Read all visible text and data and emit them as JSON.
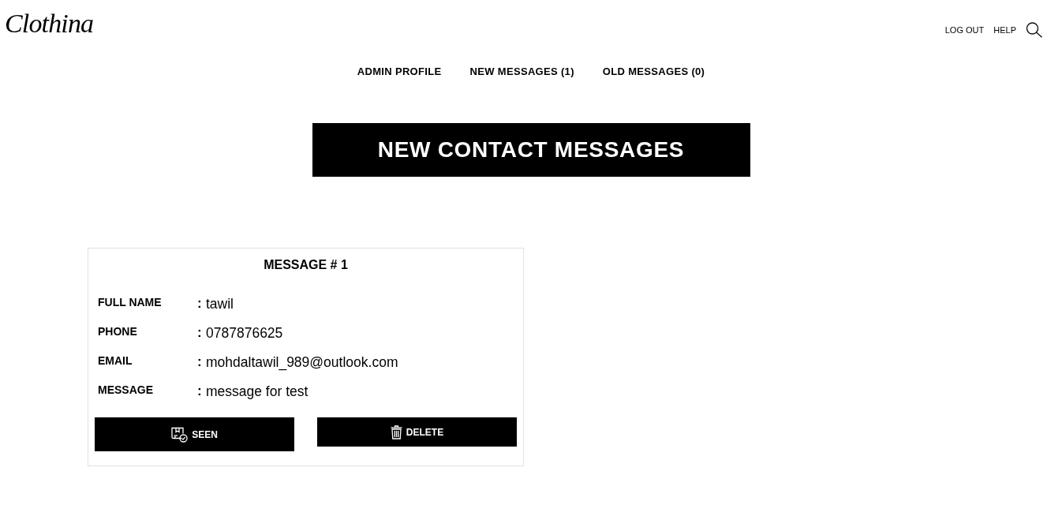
{
  "logo": {
    "text": "Clothina"
  },
  "header_links": [
    {
      "label": "LOG OUT"
    },
    {
      "label": "HELP"
    }
  ],
  "nav": [
    {
      "label": "ADMIN PROFILE"
    },
    {
      "label": "NEW MESSAGES (1)"
    },
    {
      "label": "OLD MESSAGES (0)"
    }
  ],
  "page_title": "NEW CONTACT MESSAGES",
  "messages": [
    {
      "title": "MESSAGE # 1",
      "fields": [
        {
          "label": "FULL NAME",
          "separator": ":",
          "value": "tawil"
        },
        {
          "label": "PHONE",
          "separator": ":",
          "value": "0787876625"
        },
        {
          "label": "EMAIL",
          "separator": ":",
          "value": "mohdaltawil_989@outlook.com"
        },
        {
          "label": "MESSAGE",
          "separator": ":",
          "value": "message for test"
        }
      ],
      "actions": [
        {
          "kind": "seen",
          "label": "SEEN"
        },
        {
          "kind": "delete",
          "label": "DELETE"
        }
      ]
    }
  ]
}
